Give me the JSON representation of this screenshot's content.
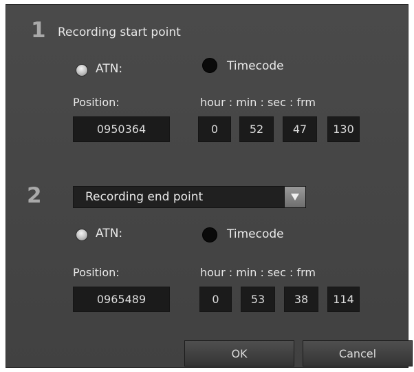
{
  "start_section": {
    "number": "1",
    "title": "Recording start point",
    "radio_atn_label": "ATN:",
    "radio_timecode_label": "Timecode",
    "position_label": "Position:",
    "timecode_label": "hour : min : sec : frm",
    "position_value": "0950364",
    "hour": "0",
    "min": "52",
    "sec": "47",
    "frm": "130"
  },
  "end_section": {
    "number": "2",
    "dropdown_value": "Recording end point",
    "radio_atn_label": "ATN:",
    "radio_timecode_label": "Timecode",
    "position_label": "Position:",
    "timecode_label": "hour : min : sec : frm",
    "position_value": "0965489",
    "hour": "0",
    "min": "53",
    "sec": "38",
    "frm": "114"
  },
  "buttons": {
    "ok_label": "OK",
    "cancel_label": "Cancel"
  },
  "colors": {
    "dialog_bg": "#454545",
    "field_bg": "#1b1b1b",
    "text": "#e8e8e8"
  },
  "icons": {
    "dropdown": "triangle-down-icon"
  }
}
